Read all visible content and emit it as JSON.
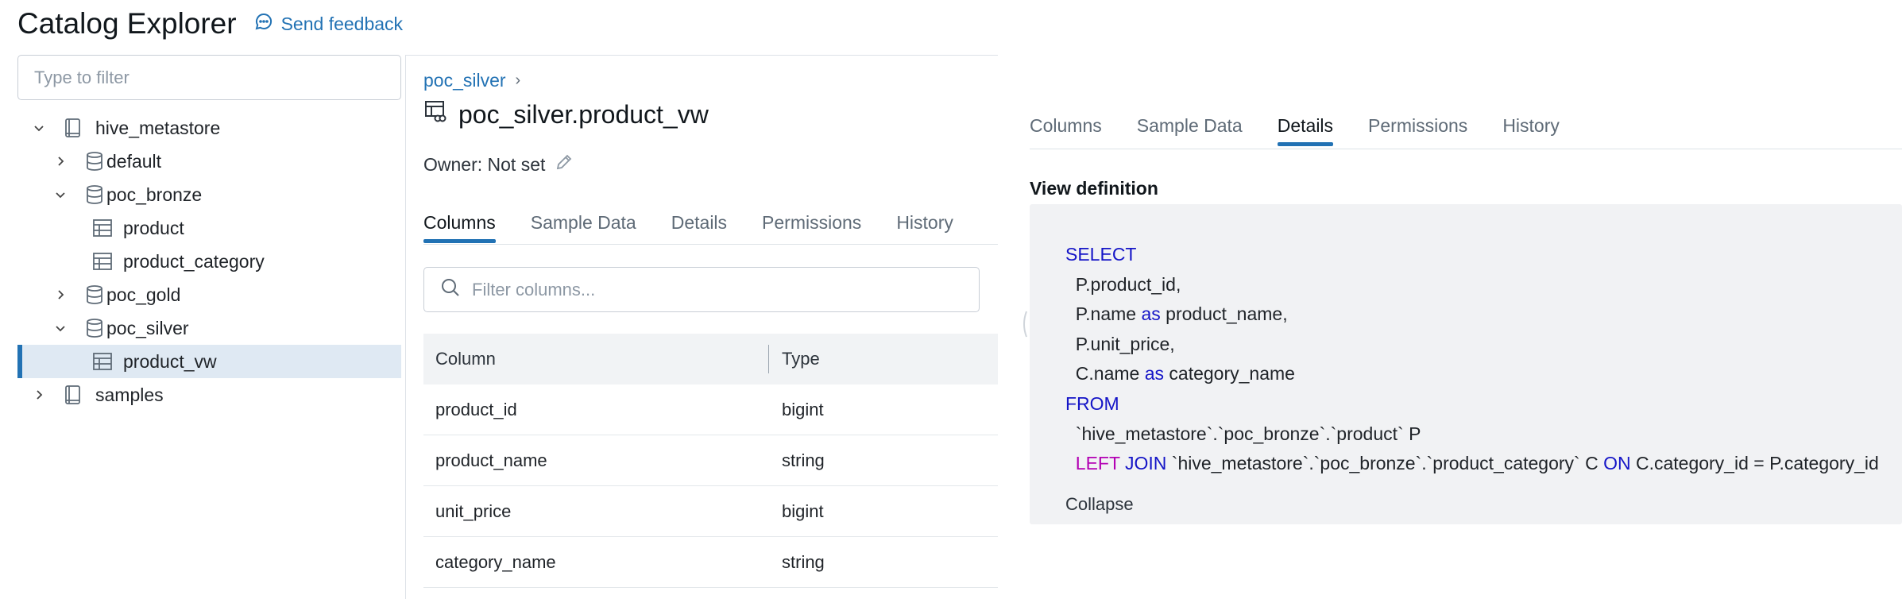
{
  "header": {
    "title": "Catalog Explorer",
    "feedback_label": "Send feedback"
  },
  "left_panel": {
    "filter_placeholder": "Type to filter",
    "tree": [
      {
        "label": "hive_metastore",
        "level": 0,
        "expanded": true,
        "icon": "catalog-icon"
      },
      {
        "label": "default",
        "level": 1,
        "expanded": false,
        "icon": "database-icon"
      },
      {
        "label": "poc_bronze",
        "level": 1,
        "expanded": true,
        "icon": "database-icon"
      },
      {
        "label": "product",
        "level": 2,
        "icon": "table-icon"
      },
      {
        "label": "product_category",
        "level": 2,
        "icon": "table-icon"
      },
      {
        "label": "poc_gold",
        "level": 1,
        "expanded": false,
        "icon": "database-icon"
      },
      {
        "label": "poc_silver",
        "level": 1,
        "expanded": true,
        "icon": "database-icon"
      },
      {
        "label": "product_vw",
        "level": 2,
        "icon": "table-icon",
        "selected": true
      },
      {
        "label": "samples",
        "level": 0,
        "expanded": false,
        "icon": "catalog-icon"
      }
    ]
  },
  "main": {
    "breadcrumb": {
      "schema": "poc_silver",
      "separator": "›"
    },
    "object_title": "poc_silver.product_vw",
    "owner_label": "Owner: Not set",
    "tabs": [
      "Columns",
      "Sample Data",
      "Details",
      "Permissions",
      "History"
    ],
    "active_tab": "Columns",
    "column_filter_placeholder": "Filter columns...",
    "table": {
      "headers": [
        "Column",
        "Type"
      ],
      "rows": [
        {
          "column": "product_id",
          "type": "bigint"
        },
        {
          "column": "product_name",
          "type": "string"
        },
        {
          "column": "unit_price",
          "type": "bigint"
        },
        {
          "column": "category_name",
          "type": "string"
        }
      ]
    }
  },
  "detail_panel": {
    "tabs": [
      "Columns",
      "Sample Data",
      "Details",
      "Permissions",
      "History"
    ],
    "active_tab": "Details",
    "section_title": "View definition",
    "sql": {
      "select_kw": "SELECT",
      "line1": "P.product_id,",
      "line2_a": "P.name ",
      "as_kw": "as",
      "line2_b": " product_name,",
      "line3": "P.unit_price,",
      "line4_a": "C.name ",
      "line4_b": " category_name",
      "from_kw": "FROM",
      "line5": "`hive_metastore`.`poc_bronze`.`product` P",
      "left_kw": "LEFT",
      "join_kw": "JOIN",
      "line6_a": " `hive_metastore`.`poc_bronze`.`product_category` C ",
      "on_kw": "ON",
      "line6_b": " C.category_id = P.category_id"
    },
    "collapse_label": "Collapse"
  },
  "colors": {
    "accent": "#2272b4",
    "selected_bg": "#dfe9f3",
    "keyword": "#1515c7",
    "keyword_join": "#b300b3",
    "code_bg": "#f1f2f4"
  }
}
